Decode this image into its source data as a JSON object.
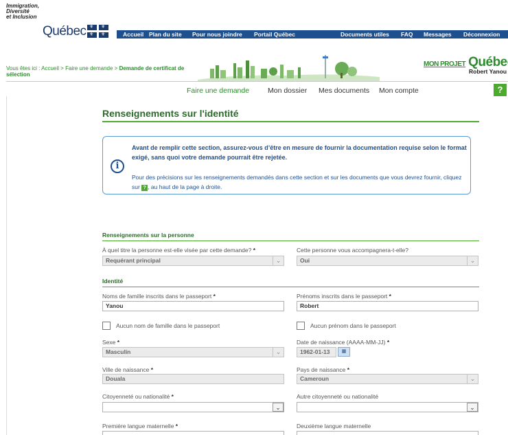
{
  "header": {
    "ministry_line1": "Immigration,",
    "ministry_line2": "Diversité",
    "ministry_line3": "et Inclusion",
    "quebec_word": "Québec",
    "topnav": [
      {
        "label": "Accueil"
      },
      {
        "label": "Plan du site"
      },
      {
        "label": "Pour nous joindre"
      },
      {
        "label": "Portail Québec"
      },
      {
        "label": "Documents utiles"
      },
      {
        "label": "FAQ"
      },
      {
        "label": "Messages"
      },
      {
        "label": "Déconnexion"
      }
    ],
    "breadcrumb_prefix": "Vous êtes ici : ",
    "breadcrumb_home": "Accueil",
    "breadcrumb_sep": " > ",
    "breadcrumb_mid": "Faire une demande",
    "breadcrumb_current": "Demande de certificat de sélection",
    "brand_small": "MON PROJET",
    "brand_big": "Québec",
    "user_name": "Robert Yanou"
  },
  "mainnav": {
    "items": [
      {
        "label": "Faire une demande",
        "active": true
      },
      {
        "label": "Mon dossier",
        "active": false
      },
      {
        "label": "Mes documents",
        "active": false
      },
      {
        "label": "Mon compte",
        "active": false
      }
    ],
    "help_label": "?"
  },
  "page": {
    "title": "Renseignements sur l'identité",
    "info_icon": "i",
    "info_line1": "Avant de remplir cette section, assurez-vous d’être en mesure de fournir la documentation requise selon le format exigé, sans quoi votre demande pourrait être rejetée.",
    "info_line2a": "Pour des précisions sur les renseignements demandés dans cette section et sur les documents que vous devrez fournir, cliquez sur ",
    "info_help_glyph": "?",
    "info_line2b": ", au haut de la page à droite."
  },
  "section_person": {
    "title": "Renseignements sur la personne",
    "q1_label": "À quel titre la personne est-elle visée par cette demande?",
    "q1_value": "Requérant principal",
    "q2_label": "Cette personne vous accompagnera-t-elle?",
    "q2_value": "Oui"
  },
  "section_identity": {
    "title": "Identité",
    "surname_label": "Noms de famille inscrits dans le passeport",
    "surname_value": "Yanou",
    "given_label": "Prénoms inscrits dans le passeport",
    "given_value": "Robert",
    "no_surname_label": "Aucun nom de famille dans le passeport",
    "no_given_label": "Aucun prénom dans le passeport",
    "sex_label": "Sexe",
    "sex_value": "Masculin",
    "dob_label": "Date de naissance (AAAA-MM-JJ)",
    "dob_value": "1962-01-13",
    "birthcity_label": "Ville de naissance",
    "birthcity_value": "Douala",
    "birthcountry_label": "Pays de naissance",
    "birthcountry_value": "Cameroun",
    "citizenship_label": "Citoyenneté ou nationalité",
    "citizenship_value": "",
    "other_citizenship_label": "Autre citoyenneté ou nationalité",
    "other_citizenship_value": "",
    "lang1_label": "Première langue maternelle",
    "lang2_label": "Deuxième langue maternelle"
  },
  "required_mark": "*",
  "dropdown_glyph": "⌄",
  "colors": {
    "accent_green": "#4caa2c",
    "title_green": "#2a6b2a",
    "nav_blue": "#1e4f8f"
  }
}
